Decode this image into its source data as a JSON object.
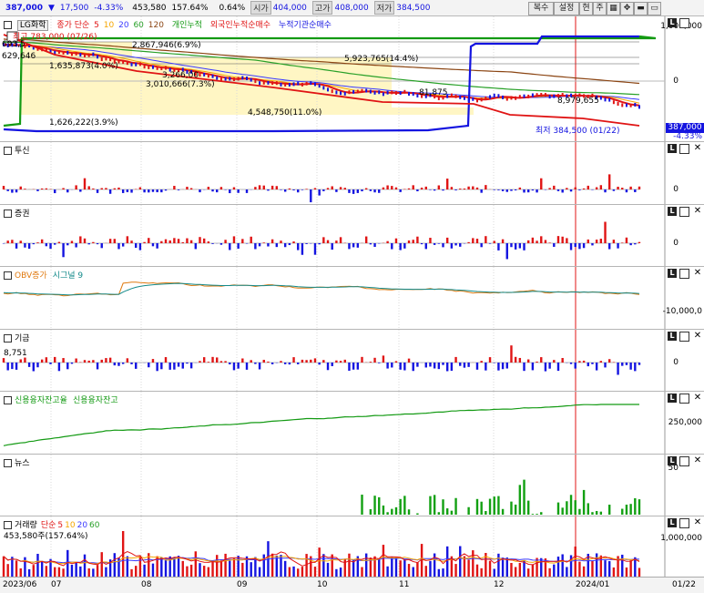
{
  "header": {
    "price": "387,000",
    "arrow": "▼",
    "change": "17,500",
    "change_pct": "-4.33%",
    "volume": "453,580",
    "volume_ratio": "157.64%",
    "turnover_pct": "0.64%",
    "open_label": "시가",
    "open": "404,000",
    "high_label": "고가",
    "high": "408,000",
    "low_label": "저가",
    "low": "384,500",
    "buttons": [
      "복수",
      "설정",
      "현",
      "주"
    ]
  },
  "price_pane": {
    "stock_name": "LG화학",
    "legend": [
      "종가 단순",
      "5",
      "10",
      "20",
      "60",
      "120",
      "개인누적",
      "외국인누적순매수",
      "누적기관순매수"
    ],
    "high_label": "최고 783,000 (07/26)",
    "low_label": "최저 384,500 (01/22)",
    "current_badge": "387,000",
    "current_pct": "-4.33%",
    "axis_top": "1,000,000",
    "axis_zero": "0",
    "left_label_1": "693,5",
    "left_label_2": "629,646",
    "annotations": [
      "2,867,946(6.9%)",
      "1,635,873(4.0%)",
      "3,266,00",
      "3,010,666(7.3%)",
      "5,923,765(14.4%)",
      "4,548,750(11.0%)",
      "1,626,222(3.9%)",
      "81,875",
      "8,979,655"
    ]
  },
  "panes": {
    "fund": {
      "title": "투신",
      "zero": "0"
    },
    "securities": {
      "title": "증권",
      "zero": "0"
    },
    "obv": {
      "title": "OBV증가",
      "signal": "시그널 9",
      "axis": "-10,000,0"
    },
    "pension": {
      "title": "기금",
      "zero": "0",
      "left_value": "8,751"
    },
    "credit": {
      "title": "신용융자잔고율",
      "sub": "신용융자잔고",
      "axis": "250,000"
    },
    "news": {
      "title": "뉴스",
      "axis": "50"
    },
    "volume": {
      "title": "거래량",
      "legend": [
        "단순",
        "5",
        "10",
        "20",
        "60"
      ],
      "value": "453,580주(157.64%)",
      "axis": "1,000,000"
    }
  },
  "xaxis": [
    "2023/06",
    "07",
    "08",
    "09",
    "10",
    "11",
    "12",
    "2024/01",
    "01/22"
  ],
  "colors": {
    "up": "#e01414",
    "down": "#1414e0",
    "news": "#12a012",
    "credit": "#139a13",
    "ma5": "#e01414",
    "ma10": "#f5a600",
    "ma20": "#3a3aff",
    "ma60": "#28a028",
    "ma120": "#8b4513"
  }
}
